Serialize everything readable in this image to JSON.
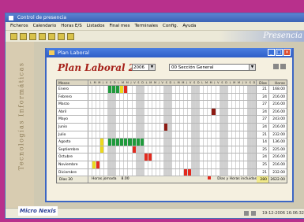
{
  "app": {
    "title": "Control de presencia",
    "brand": "Presencia",
    "menu": [
      "Ficheros",
      "Calendario",
      "Horas E/S",
      "Listados",
      "Final mes",
      "Terminales",
      "Config.",
      "Ayuda"
    ],
    "side_text": "Tecnologías Informáticas",
    "logo": "Micro Nexis",
    "status_date": "19-12-2006",
    "status_time": "16:06:32"
  },
  "window": {
    "title": "Plan Laboral",
    "heading": "Plan Laboral 2006",
    "year": "2006",
    "section": "00 Sección General"
  },
  "table": {
    "headers": {
      "month": "Meses",
      "days": "L M M J V S D L M M J V S D L M M J V S D L M M J V S D L M M J V S D L M M J V S D",
      "dias": "Días",
      "horas": "Horas"
    },
    "months": [
      {
        "name": "Enero",
        "dias": "21",
        "horas": "168.00"
      },
      {
        "name": "Febrero",
        "dias": "24",
        "horas": "216.00"
      },
      {
        "name": "Marzo",
        "dias": "27",
        "horas": "216.00"
      },
      {
        "name": "Abril",
        "dias": "24",
        "horas": "216.00"
      },
      {
        "name": "Mayo",
        "dias": "27",
        "horas": "243.00"
      },
      {
        "name": "Junio",
        "dias": "24",
        "horas": "216.00"
      },
      {
        "name": "Julio",
        "dias": "21",
        "horas": "232.00"
      },
      {
        "name": "Agosto",
        "dias": "14",
        "horas": "136.00"
      },
      {
        "name": "Septiembre",
        "dias": "25",
        "horas": "225.00"
      },
      {
        "name": "Octubre",
        "dias": "24",
        "horas": "216.00"
      },
      {
        "name": "Noviembre",
        "dias": "25",
        "horas": "216.00"
      },
      {
        "name": "Diciembre",
        "dias": "21",
        "horas": "232.00"
      }
    ],
    "footer": {
      "dias_label": "Días 30",
      "jornada_label": "Horas jornada",
      "jornada_value": "8.00",
      "legend_label": "Días y Horas incluidas",
      "total_dias": "280",
      "total_horas": "2622.00"
    },
    "colors": {
      "weekend": "#d0d0d0",
      "holiday": "#e32a1e",
      "vacation": "#1f9a3c",
      "partial": "#ecd91d",
      "special": "#8d1a12"
    }
  }
}
